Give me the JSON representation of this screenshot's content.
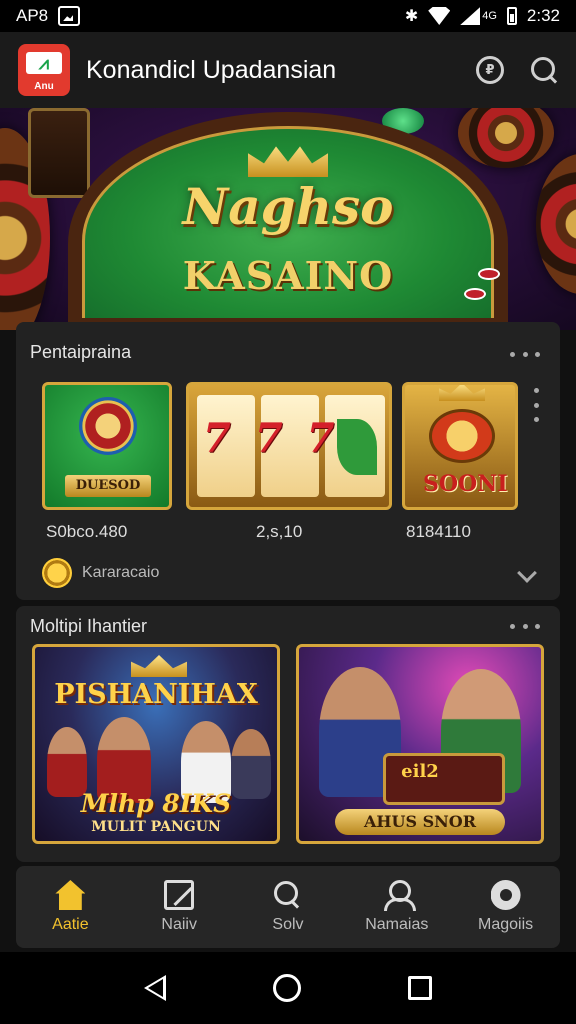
{
  "status_bar": {
    "carrier": "AP8",
    "time": "2:32",
    "network": "4G"
  },
  "app_bar": {
    "logo_text": "Anu",
    "title": "Konandicl Upadansian"
  },
  "hero": {
    "title": "Naghso",
    "subtitle": "KASAINO"
  },
  "section1": {
    "title": "Pentaipraina",
    "tiles": [
      {
        "label": "DUESOD",
        "price": "S0bco.480"
      },
      {
        "label": "777",
        "price": "2,s,10"
      },
      {
        "label": "SOONI",
        "price": "8184110"
      }
    ],
    "footer_text": "Kararacaio"
  },
  "section2": {
    "title": "Moltipi Ihantier",
    "tiles": [
      {
        "title": "PISHANIHAX",
        "subtitle": "Mlhp 8IKS",
        "caption": "MULIT PANGUN"
      },
      {
        "title": "eil2",
        "caption": "AHUS SNOR"
      }
    ]
  },
  "bottom_nav": {
    "items": [
      {
        "label": "Aatie",
        "icon": "home-icon",
        "active": true
      },
      {
        "label": "Naiiv",
        "icon": "edit-icon",
        "active": false
      },
      {
        "label": "Solv",
        "icon": "search-icon",
        "active": false
      },
      {
        "label": "Namaias",
        "icon": "user-icon",
        "active": false
      },
      {
        "label": "Magoiis",
        "icon": "people-icon",
        "active": false
      }
    ]
  },
  "colors": {
    "accent": "#f2c22e",
    "felt": "#1f8a34",
    "gold": "#d6a63c"
  }
}
